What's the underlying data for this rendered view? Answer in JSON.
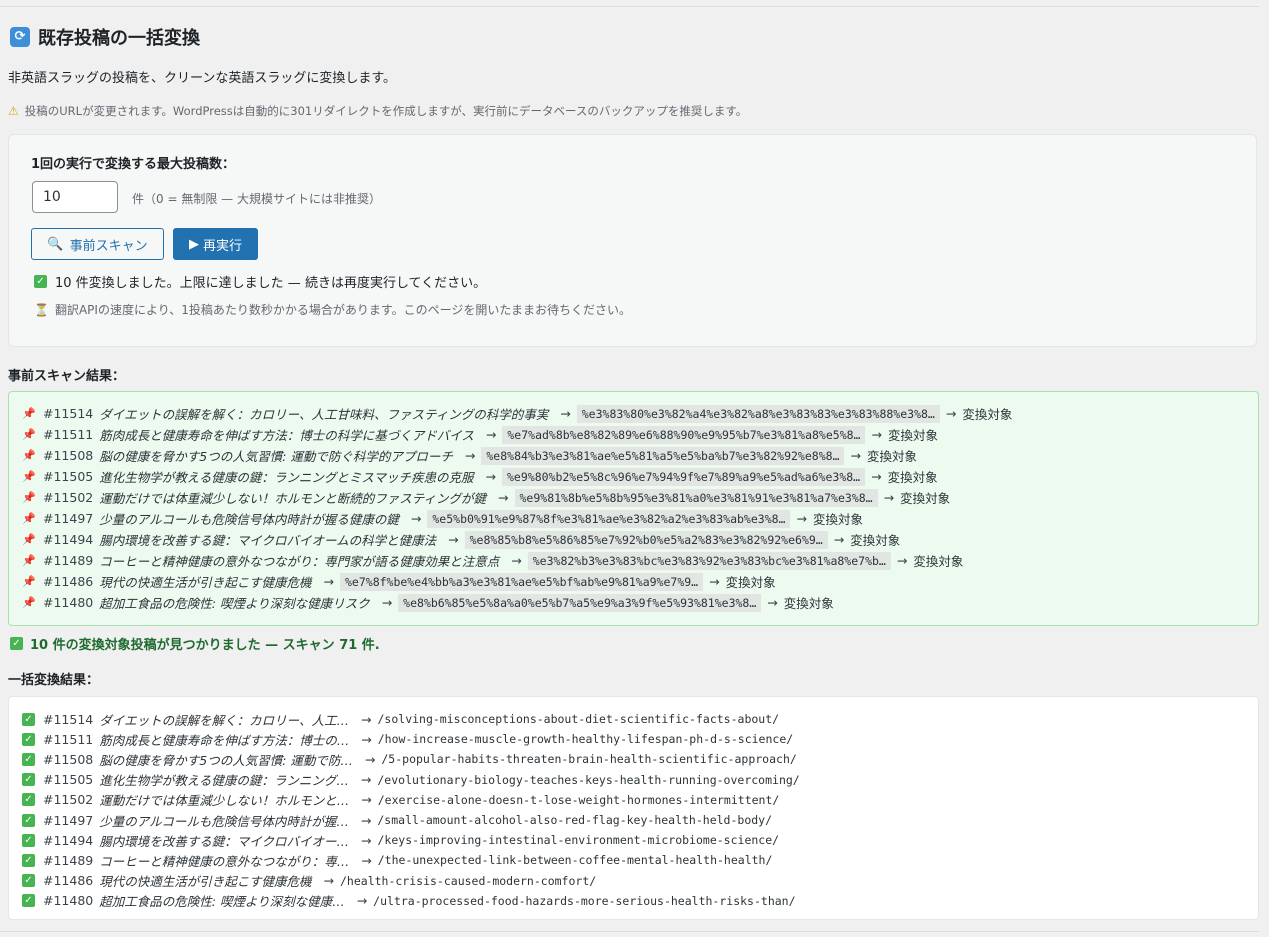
{
  "header": {
    "title": "既存投稿の一括変換",
    "description": "非英語スラッグの投稿を、クリーンな英語スラッグに変換します。",
    "warning": "投稿のURLが変更されます。WordPressは自動的に301リダイレクトを作成しますが、実行前にデータベースのバックアップを推奨します。"
  },
  "settings": {
    "max_label": "1回の実行で変換する最大投稿数：",
    "max_value": "10",
    "max_unit": "件（0 = 無制限 — 大規模サイトには非推奨）",
    "scan_button": "事前スキャン",
    "run_button": "再実行",
    "status_message": "10 件変換しました。上限に達しました — 続きは再度実行してください。",
    "hint": "翻訳APIの速度により、1投稿あたり数秒かかる場合があります。このページを開いたままお待ちください。"
  },
  "scan": {
    "heading": "事前スキャン結果：",
    "arrow": "→",
    "target_label": "変換対象",
    "items": [
      {
        "id": "#11514",
        "title": "ダイエットの誤解を解く：カロリー、人工甘味料、ファスティングの科学的事実",
        "slug": "%e3%83%80%e3%82%a4%e3%82%a8%e3%83%83%e3%83%88%e3%8…"
      },
      {
        "id": "#11511",
        "title": "筋肉成長と健康寿命を伸ばす方法：博士の科学に基づくアドバイス",
        "slug": "%e7%ad%8b%e8%82%89%e6%88%90%e9%95%b7%e3%81%a8%e5%8…"
      },
      {
        "id": "#11508",
        "title": "脳の健康を脅かす5つの人気習慣: 運動で防ぐ科学的アプローチ",
        "slug": "%e8%84%b3%e3%81%ae%e5%81%a5%e5%ba%b7%e3%82%92%e8%8…"
      },
      {
        "id": "#11505",
        "title": "進化生物学が教える健康の鍵：ランニングとミスマッチ疾患の克服",
        "slug": "%e9%80%b2%e5%8c%96%e7%94%9f%e7%89%a9%e5%ad%a6%e3%8…"
      },
      {
        "id": "#11502",
        "title": "運動だけでは体重減少しない！ホルモンと断続的ファスティングが鍵",
        "slug": "%e9%81%8b%e5%8b%95%e3%81%a0%e3%81%91%e3%81%a7%e3%8…"
      },
      {
        "id": "#11497",
        "title": "少量のアルコールも危険信号体内時計が握る健康の鍵",
        "slug": "%e5%b0%91%e9%87%8f%e3%81%ae%e3%82%a2%e3%83%ab%e3%8…"
      },
      {
        "id": "#11494",
        "title": "腸内環境を改善する鍵：マイクロバイオームの科学と健康法",
        "slug": "%e8%85%b8%e5%86%85%e7%92%b0%e5%a2%83%e3%82%92%e6%9…"
      },
      {
        "id": "#11489",
        "title": " コーヒーと精神健康の意外なつながり：専門家が語る健康効果と注意点 ",
        "slug": "%e3%82%b3%e3%83%bc%e3%83%92%e3%83%bc%e3%81%a8%e7%b…"
      },
      {
        "id": "#11486",
        "title": "現代の快適生活が引き起こす健康危機",
        "slug": "%e7%8f%be%e4%bb%a3%e3%81%ae%e5%bf%ab%e9%81%a9%e7%9…"
      },
      {
        "id": "#11480",
        "title": "超加工食品の危険性: 喫煙より深刻な健康リスク",
        "slug": "%e8%b6%85%e5%8a%a0%e5%b7%a5%e9%a3%9f%e5%93%81%e3%8…"
      }
    ],
    "summary": "10 件の変換対象投稿が見つかりました — スキャン 71 件."
  },
  "results": {
    "heading": "一括変換結果：",
    "arrow": "→",
    "items": [
      {
        "id": "#11514",
        "title": "ダイエットの誤解を解く：カロリー、人工…",
        "slug": "/solving-misconceptions-about-diet-scientific-facts-about/"
      },
      {
        "id": "#11511",
        "title": "筋肉成長と健康寿命を伸ばす方法：博士の…",
        "slug": "/how-increase-muscle-growth-healthy-lifespan-ph-d-s-science/"
      },
      {
        "id": "#11508",
        "title": "脳の健康を脅かす5つの人気習慣: 運動で防…",
        "slug": "/5-popular-habits-threaten-brain-health-scientific-approach/"
      },
      {
        "id": "#11505",
        "title": "進化生物学が教える健康の鍵：ランニング…",
        "slug": "/evolutionary-biology-teaches-keys-health-running-overcoming/"
      },
      {
        "id": "#11502",
        "title": "運動だけでは体重減少しない！ホルモンと…",
        "slug": "/exercise-alone-doesn-t-lose-weight-hormones-intermittent/"
      },
      {
        "id": "#11497",
        "title": "少量のアルコールも危険信号体内時計が握…",
        "slug": "/small-amount-alcohol-also-red-flag-key-health-held-body/"
      },
      {
        "id": "#11494",
        "title": "腸内環境を改善する鍵：マイクロバイオー…",
        "slug": "/keys-improving-intestinal-environment-microbiome-science/"
      },
      {
        "id": "#11489",
        "title": " コーヒーと精神健康の意外なつながり：専…",
        "slug": "/the-unexpected-link-between-coffee-mental-health-health/"
      },
      {
        "id": "#11486",
        "title": "現代の快適生活が引き起こす健康危機",
        "slug": "/health-crisis-caused-modern-comfort/"
      },
      {
        "id": "#11480",
        "title": "超加工食品の危険性: 喫煙より深刻な健康…",
        "slug": "/ultra-processed-food-hazards-more-serious-health-risks-than/"
      }
    ]
  },
  "icons": {
    "refresh": "refresh-icon",
    "warning": "warning-icon",
    "search": "search-icon",
    "play": "play-icon",
    "check": "check-icon",
    "hourglass": "hourglass-icon",
    "pin": "pin-icon"
  },
  "colors": {
    "accent": "#2271b1",
    "success": "#46b450",
    "success_bg": "#edfaef",
    "pin": "#d63638"
  }
}
